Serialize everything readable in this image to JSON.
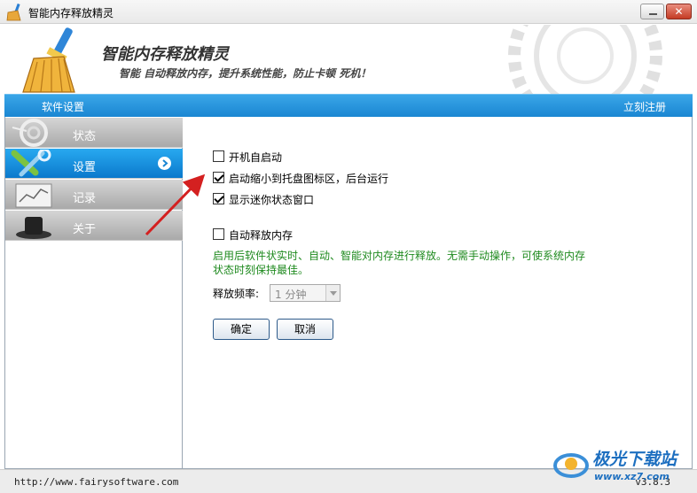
{
  "window": {
    "title": "智能内存释放精灵",
    "minimize": "",
    "close": "✕"
  },
  "header": {
    "title": "智能内存释放精灵",
    "subtitle": "智能 自动释放内存，提升系统性能，防止卡顿 死机！"
  },
  "nav": {
    "left": "软件设置",
    "right": "立刻注册"
  },
  "sidebar": {
    "items": [
      {
        "label": "状态",
        "icon": "gauge-icon",
        "active": false
      },
      {
        "label": "设置",
        "icon": "tools-icon",
        "active": true
      },
      {
        "label": "记录",
        "icon": "chart-icon",
        "active": false
      },
      {
        "label": "关于",
        "icon": "hat-icon",
        "active": false
      }
    ]
  },
  "settings": {
    "autostart": {
      "label": "开机自启动",
      "checked": false
    },
    "minimize_tray": {
      "label": "启动缩小到托盘图标区，后台运行",
      "checked": true
    },
    "mini_window": {
      "label": "显示迷你状态窗口",
      "checked": true
    },
    "auto_release": {
      "label": "自动释放内存",
      "checked": false
    },
    "description": "启用后软件状实时、自动、智能对内存进行释放。无需手动操作，可使系统内存状态时刻保持最佳。",
    "frequency_label": "释放频率:",
    "frequency_value": "1 分钟",
    "ok": "确定",
    "cancel": "取消"
  },
  "statusbar": {
    "url": "http://www.fairysoftware.com",
    "version": "v3.8.3"
  },
  "watermark": {
    "brand": "极光下载站",
    "site": "www.xz7.com"
  },
  "colors": {
    "nav_blue": "#1a86d2",
    "active_item": "#0b79cc",
    "desc_green": "#1f8a1f",
    "arrow_red": "#d42020"
  }
}
